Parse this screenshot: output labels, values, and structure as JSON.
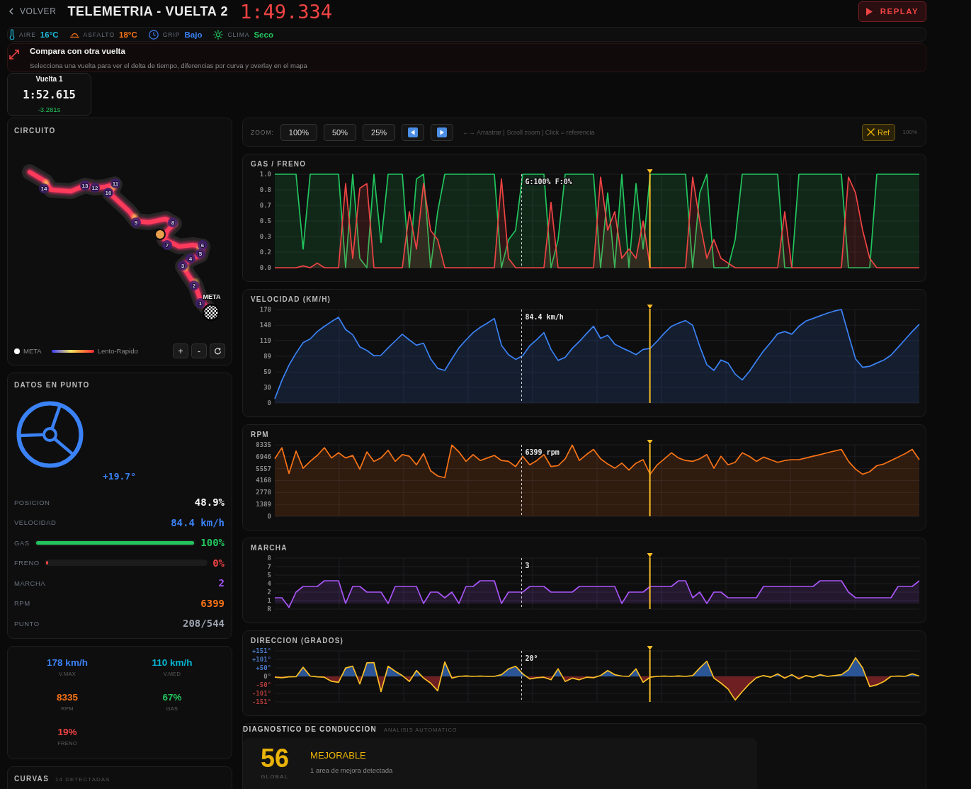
{
  "header": {
    "back": "VOLVER",
    "title": "TELEMETRIA - VUELTA 2",
    "lap_time": "1:49.334",
    "replay": "REPLAY"
  },
  "conditions": [
    {
      "kind": "air",
      "label": "AIRE",
      "value": "16°C",
      "color": "#1fb8d8"
    },
    {
      "kind": "track",
      "label": "ASFALTO",
      "value": "18°C",
      "color": "#f97316"
    },
    {
      "kind": "grip",
      "label": "GRIP",
      "value": "Bajo",
      "color": "#3b82f6"
    },
    {
      "kind": "weather",
      "label": "CLIMA",
      "value": "Seco",
      "color": "#22c55e"
    }
  ],
  "compare": {
    "title": "Compara con otra vuelta",
    "subtitle": "Selecciona una vuelta para ver el delta de tiempo, diferencias por curva y overlay en el mapa"
  },
  "laps": [
    {
      "label": "Vuelta 1",
      "time": "1:52.615",
      "delta": "-3.281s",
      "selected": false
    }
  ],
  "circuit": {
    "title": "CIRCUITO",
    "turns": [
      "1",
      "2",
      "3",
      "4",
      "5",
      "6",
      "7",
      "8",
      "9",
      "10",
      "11",
      "12",
      "13",
      "14"
    ],
    "finish_label": "META",
    "legend": {
      "finish": "META",
      "scale": "Lento-Rapido"
    },
    "controls": [
      "+",
      "-"
    ]
  },
  "point_data": {
    "title": "DATOS EN PUNTO",
    "steering": "+19.7°",
    "rows": [
      {
        "kind": "text",
        "label": "POSICION",
        "value": "48.9%",
        "color": "#f5f5f5"
      },
      {
        "kind": "text",
        "label": "VELOCIDAD",
        "value": "84.4 km/h",
        "color": "#3b82f6"
      },
      {
        "kind": "bar",
        "label": "GAS",
        "value": "100%",
        "level": 1,
        "color": "#22c55e"
      },
      {
        "kind": "bar",
        "label": "FRENO",
        "value": "0%",
        "level": 0,
        "color": "#ef4444"
      },
      {
        "kind": "text",
        "label": "MARCHA",
        "value": "2",
        "color": "#a855f7"
      },
      {
        "kind": "text",
        "label": "RPM",
        "value": "6399",
        "color": "#f97316"
      },
      {
        "kind": "text",
        "label": "PUNTO",
        "value": "208/544",
        "color": "#9ca3af"
      }
    ]
  },
  "summary": [
    {
      "value": "178 km/h",
      "label": "V.MAX",
      "color": "#3b82f6"
    },
    {
      "value": "110 km/h",
      "label": "V.MED",
      "color": "#06b6d4"
    },
    {
      "value": "8335",
      "label": "RPM",
      "color": "#f97316"
    },
    {
      "value": "67%",
      "label": "GAS",
      "color": "#22c55e"
    },
    {
      "value": "19%",
      "label": "FRENO",
      "color": "#ef4444"
    }
  ],
  "curves": {
    "title": "CURVAS",
    "count": "14 DETECTADAS"
  },
  "toolbar": {
    "label": "ZOOM:",
    "zoom_options": [
      {
        "label": "100%",
        "selected": false
      },
      {
        "label": "50%",
        "selected": false
      },
      {
        "label": "25%",
        "selected": false
      }
    ],
    "hint": "←→ Arrastrar | Scroll zoom | Click = referencia",
    "ref_button": "Ref",
    "zoom_level": "100%"
  },
  "charts": [
    {
      "chart_data": {
        "type": "area",
        "title": "GAS / FRENO",
        "ylim": [
          0,
          1
        ],
        "yticks": [
          {
            "value": 1,
            "label": "1.0"
          },
          {
            "value": 0.833,
            "label": "0.8"
          },
          {
            "value": 0.667,
            "label": "0.7"
          },
          {
            "value": 0.5,
            "label": "0.5"
          },
          {
            "value": 0.333,
            "label": "0.3"
          },
          {
            "value": 0.167,
            "label": "0.2"
          },
          {
            "value": 0,
            "label": "0.0"
          }
        ],
        "grid": true,
        "series": [
          {
            "color": "#22c55e",
            "values": [
              1,
              1,
              1,
              1,
              0.2,
              1,
              1,
              1,
              1,
              1,
              0,
              1,
              0.1,
              0,
              1,
              0.27,
              1,
              1,
              1,
              0,
              0.95,
              1,
              0,
              0.6,
              1,
              1,
              1,
              1,
              1,
              1,
              1,
              1,
              0,
              0.3,
              0.4,
              1,
              1,
              1,
              1,
              0,
              0.3,
              1,
              1,
              1,
              1,
              1,
              0,
              0.8,
              0,
              1,
              0,
              0.9,
              0.2,
              1,
              1,
              1,
              1,
              1,
              1,
              0,
              0.8,
              1,
              0,
              0,
              0,
              0.3,
              1,
              1,
              1,
              1,
              1,
              1,
              0,
              0,
              1,
              1,
              1,
              1,
              1,
              1,
              1,
              0,
              0,
              0,
              0,
              1,
              1,
              1,
              1,
              1,
              1,
              1
            ]
          },
          {
            "color": "#ef4444",
            "values": [
              0,
              0,
              0,
              0,
              0.02,
              0,
              0.05,
              0,
              0,
              0,
              0.9,
              0.1,
              0.85,
              0.9,
              0,
              0,
              0,
              0,
              0,
              0.6,
              0.2,
              0.9,
              0.4,
              0.3,
              0,
              0,
              0,
              0,
              0,
              0,
              0,
              0,
              0.95,
              0.1,
              0,
              0,
              0,
              0,
              0,
              0.7,
              0,
              0,
              0,
              0,
              0,
              0,
              0.97,
              0.4,
              0.6,
              0.1,
              0.2,
              0.1,
              0.5,
              0,
              0,
              0,
              0,
              0,
              0,
              0.97,
              0.5,
              0.1,
              0.3,
              0.1,
              0.05,
              0,
              0,
              0,
              0,
              0,
              0,
              0,
              0.6,
              0,
              0,
              0,
              0,
              0,
              0,
              0,
              0,
              0.97,
              0.8,
              0.4,
              0.1,
              0,
              0,
              0,
              0,
              0,
              0,
              0
            ]
          }
        ],
        "annotations": [
          "G:100% F:0%"
        ]
      }
    },
    {
      "chart_data": {
        "type": "area",
        "title": "VELOCIDAD (KM/H)",
        "ylim": [
          0,
          178
        ],
        "yticks": [
          0,
          30,
          59,
          89,
          119,
          148,
          178
        ],
        "grid": true,
        "series": [
          {
            "color": "#3b82f6",
            "values": [
              8,
              43,
              72,
              95,
              115,
              122,
              136,
              146,
              155,
              163,
              140,
              130,
              107,
              100,
              90,
              91,
              105,
              118,
              131,
              120,
              110,
              114,
              84,
              66,
              62,
              84,
              105,
              120,
              134,
              144,
              152,
              161,
              110,
              92,
              83,
              90,
              109,
              121,
              134,
              102,
              81,
              87,
              104,
              117,
              132,
              146,
              123,
              129,
              112,
              105,
              99,
              92,
              102,
              104,
              118,
              133,
              146,
              152,
              157,
              148,
              108,
              73,
              62,
              82,
              76,
              55,
              44,
              60,
              80,
              99,
              115,
              132,
              136,
              131,
              146,
              156,
              161,
              166,
              171,
              175,
              178,
              130,
              84,
              68,
              70,
              76,
              82,
              91,
              106,
              121,
              136,
              150
            ]
          }
        ],
        "annotations": [
          "84.4 km/h"
        ]
      }
    },
    {
      "chart_data": {
        "type": "area",
        "title": "RPM",
        "ylim": [
          0,
          8335
        ],
        "yticks": [
          0,
          1389,
          2778,
          4168,
          5557,
          6946,
          8335
        ],
        "grid": true,
        "series": [
          {
            "color": "#f97316",
            "values": [
              6700,
              8000,
              5000,
              7600,
              5600,
              6400,
              7100,
              8000,
              6800,
              7400,
              6800,
              7100,
              5500,
              7500,
              6400,
              6800,
              7700,
              6400,
              7200,
              7000,
              6000,
              7300,
              5300,
              4700,
              4500,
              8300,
              7500,
              6400,
              7200,
              6500,
              6800,
              7100,
              6500,
              6400,
              5800,
              7000,
              6000,
              6500,
              7200,
              5800,
              5900,
              6700,
              8300,
              6500,
              7200,
              7800,
              6700,
              6100,
              5600,
              6200,
              5400,
              6200,
              6600,
              4900,
              6000,
              6700,
              7400,
              6800,
              6500,
              6400,
              6700,
              7200,
              5600,
              7000,
              6000,
              6300,
              7400,
              7000,
              6400,
              6900,
              6600,
              6300,
              6500,
              6600,
              6600,
              6800,
              7000,
              7200,
              7400,
              7600,
              7800,
              6400,
              5500,
              4900,
              5200,
              5900,
              6100,
              6500,
              6900,
              7300,
              7800,
              6600
            ]
          }
        ],
        "annotations": [
          "6399 rpm"
        ]
      }
    },
    {
      "chart_data": {
        "type": "area",
        "title": "MARCHA",
        "ylim": [
          -1,
          8
        ],
        "yticks": [
          {
            "value": 8,
            "label": "8"
          },
          {
            "value": 6.5,
            "label": "7"
          },
          {
            "value": 5,
            "label": "5"
          },
          {
            "value": 3.5,
            "label": "4"
          },
          {
            "value": 2,
            "label": "2"
          },
          {
            "value": 0.5,
            "label": "1"
          },
          {
            "value": -1,
            "label": "R"
          }
        ],
        "grid": true,
        "series": [
          {
            "color": "#a855f7",
            "values": [
              1,
              1,
              -0.7,
              2,
              3,
              3,
              3,
              4,
              4,
              4,
              0,
              3,
              3,
              2,
              2,
              2,
              0,
              3,
              3,
              3,
              3,
              0,
              2,
              2,
              1,
              2,
              0,
              3,
              3,
              4,
              4,
              4,
              0,
              2,
              2,
              2,
              3,
              3,
              3,
              2,
              2,
              2,
              2,
              3,
              3,
              3,
              3,
              3,
              3,
              0,
              2,
              2,
              2,
              3,
              3,
              3,
              3,
              4,
              4,
              1,
              2,
              0,
              2,
              2,
              1,
              1,
              1,
              1,
              1,
              3,
              3,
              3,
              3,
              3,
              3,
              3,
              3,
              4,
              4,
              4,
              4,
              2,
              1,
              1,
              1,
              1,
              1,
              1,
              3,
              3,
              3,
              4
            ]
          }
        ],
        "annotations": [
          "3"
        ]
      }
    },
    {
      "chart_data": {
        "type": "area",
        "title": "DIRECCION (GRADOS)",
        "ylim": [
          -151,
          151
        ],
        "yticks": [
          {
            "value": 151,
            "label": "+151°"
          },
          {
            "value": 101,
            "label": "+101°"
          },
          {
            "value": 50,
            "label": "+50°"
          },
          {
            "value": 0,
            "label": "0°"
          },
          {
            "value": -50,
            "label": "-50°"
          },
          {
            "value": -101,
            "label": "-101°"
          },
          {
            "value": -151,
            "label": "-151°"
          }
        ],
        "grid": true,
        "series": [
          {
            "color": "#fbbf24",
            "values": [
              -5,
              -8,
              -3,
              -2,
              54,
              2,
              -3,
              -5,
              -29,
              -35,
              50,
              60,
              -45,
              80,
              82,
              -90,
              60,
              30,
              5,
              -30,
              35,
              -10,
              -40,
              -85,
              85,
              -10,
              0,
              3,
              0,
              2,
              0,
              0,
              10,
              45,
              60,
              15,
              -15,
              -8,
              -5,
              -20,
              45,
              -30,
              -10,
              -20,
              -5,
              -8,
              5,
              35,
              10,
              2,
              0,
              45,
              -35,
              -5,
              0,
              2,
              0,
              3,
              0,
              5,
              50,
              90,
              -10,
              -40,
              -75,
              -140,
              -90,
              -45,
              -8,
              5,
              -5,
              15,
              -10,
              10,
              -15,
              5,
              -5,
              10,
              0,
              5,
              10,
              40,
              110,
              50,
              -60,
              -50,
              -30,
              0,
              2,
              0,
              15,
              2
            ]
          }
        ],
        "annotations": [
          "20°"
        ]
      }
    }
  ],
  "diagnosis": {
    "title": "DIAGNOSTICO DE CONDUCCION",
    "subtitle": "ANALISIS AUTOMATICO",
    "score": "56",
    "score_label": "GLOBAL",
    "verdict": "MEJORABLE",
    "detail": "1 area de mejora detectada"
  }
}
